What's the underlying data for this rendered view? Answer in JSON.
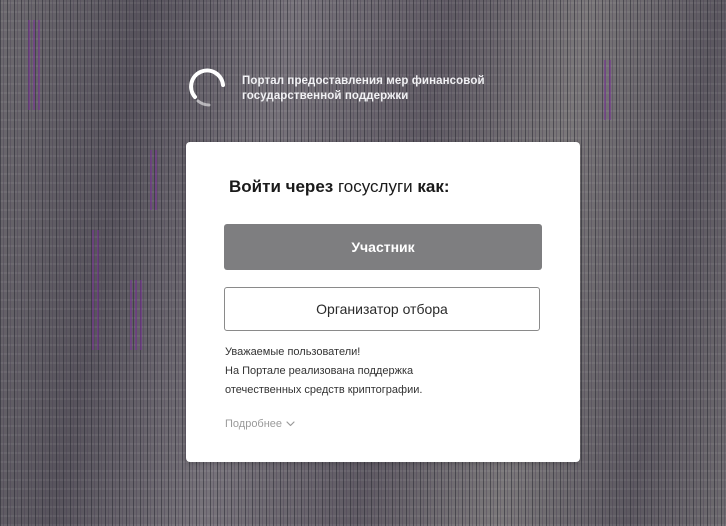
{
  "brand": {
    "logo_icon": "gosuslugi-spinner-logo-icon",
    "title_line1": "Портал предоставления мер финансовой",
    "title_line2": "государственной поддержки"
  },
  "login": {
    "title_prefix": "Войти через",
    "title_service": "госуслуги",
    "title_suffix": "как:",
    "participant_button": "Участник",
    "organizer_button": "Организатор отбора"
  },
  "notice": {
    "line1": "Уважаемые пользователи!",
    "line2": "На Портале реализована поддержка",
    "line3": "отечественных средств криптографии.",
    "more_link": "Подробнее",
    "more_icon": "chevron-down-icon"
  },
  "colors": {
    "primary_button": "#7e7e80",
    "card_background": "#ffffff",
    "link_color": "#9a9a9a"
  }
}
